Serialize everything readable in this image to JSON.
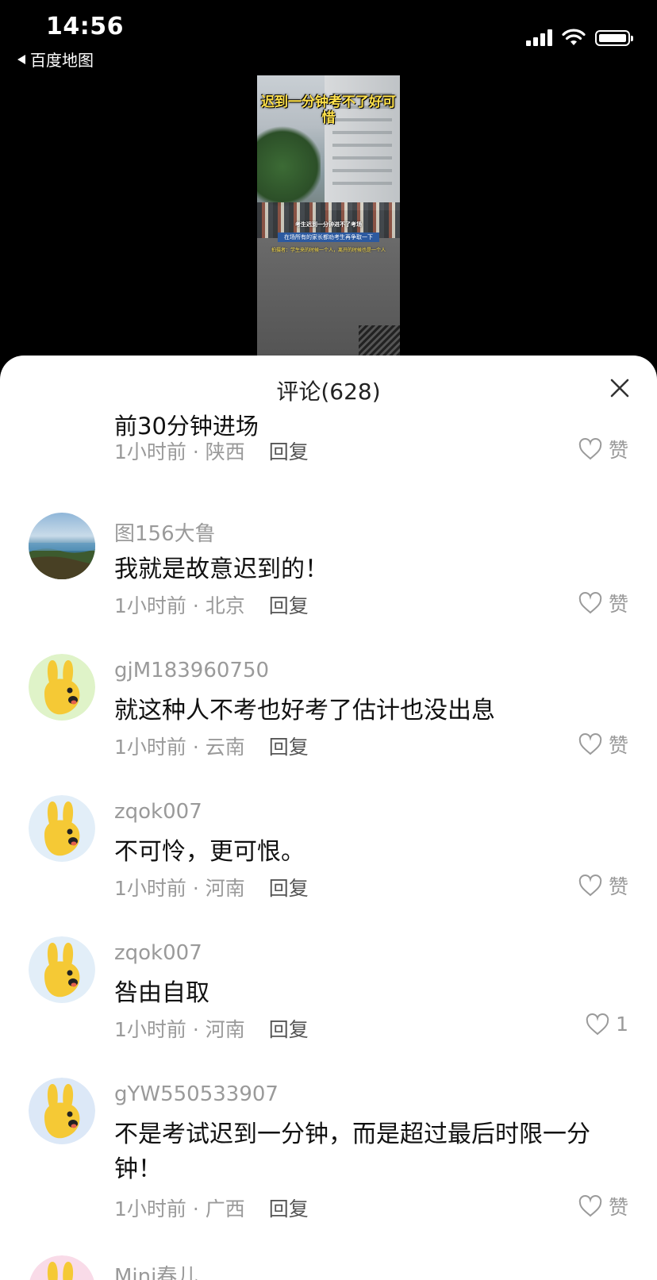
{
  "status_bar": {
    "time": "14:56",
    "back_app": "百度地图"
  },
  "video": {
    "title": "迟到一分钟考不了好可惜",
    "caption_1": "考生迟到一分钟进不了考场",
    "caption_2": "在场所有的家长都劝考生再争取一下",
    "caption_3": "拍摄者：学生来的时候一个人，离开的时候也是一个人"
  },
  "comments_sheet": {
    "title": "评论(628)",
    "partial": {
      "text": "前30分钟进场",
      "meta": "1小时前 · 陕西",
      "reply": "回复",
      "like": "赞"
    },
    "comments": [
      {
        "username": "图156大鲁",
        "text": "我就是故意迟到的！",
        "meta": "1小时前 · 北京",
        "reply": "回复",
        "like": "赞",
        "avatar": "landscape-photo"
      },
      {
        "username": "gjM183960750",
        "text": "就这种人不考也好考了估计也没出息",
        "meta": "1小时前 · 云南",
        "reply": "回复",
        "like": "赞",
        "avatar": "yellow-bunny-green"
      },
      {
        "username": "zqok007",
        "text": "不可怜，更可恨。",
        "meta": "1小时前 · 河南",
        "reply": "回复",
        "like": "赞",
        "avatar": "yellow-bunny-blue"
      },
      {
        "username": "zqok007",
        "text": "咎由自取",
        "meta": "1小时前 · 河南",
        "reply": "回复",
        "like": "1",
        "avatar": "yellow-bunny-blue"
      },
      {
        "username": "gYW550533907",
        "text": "不是考试迟到一分钟，而是超过最后时限一分钟！",
        "meta": "1小时前 · 广西",
        "reply": "回复",
        "like": "赞",
        "avatar": "yellow-bunny-blue"
      },
      {
        "username": "Mini春儿",
        "avatar": "yellow-bunny-pink"
      }
    ]
  },
  "colors": {
    "muted_text": "#9a9a9a",
    "main_text": "#111111",
    "bunny_yellow": "#f5c935"
  }
}
